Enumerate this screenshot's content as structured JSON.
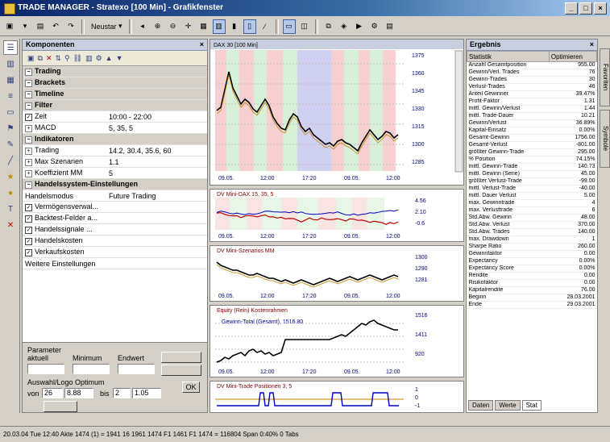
{
  "window": {
    "title": "TRADE MANAGER - Stratexo [100 Min] - Grafikfenster"
  },
  "toolbar": {
    "zoom_label": "Neustar"
  },
  "left_panel": {
    "title": "Komponenten",
    "rows": [
      {
        "type": "group",
        "label": "Trading"
      },
      {
        "type": "group",
        "label": "Brackets"
      },
      {
        "type": "group",
        "label": "Timeline"
      },
      {
        "type": "group",
        "label": "Filter"
      },
      {
        "type": "prop",
        "icon": "check",
        "key": "Zeit",
        "value": "10:00 - 22:00"
      },
      {
        "type": "prop",
        "icon": "plus",
        "key": "MACD",
        "value": "5, 35, 5"
      },
      {
        "type": "group",
        "label": "Indikatoren"
      },
      {
        "type": "prop",
        "icon": "plus",
        "key": "Trading",
        "value": "14.2, 30.4, 35.6, 60"
      },
      {
        "type": "prop",
        "icon": "plus",
        "key": "Max Szenarien",
        "value": "1.1"
      },
      {
        "type": "prop",
        "icon": "plus",
        "key": "Koeffizient MM",
        "value": "5"
      },
      {
        "type": "group",
        "label": "Handelssystem-Einstellungen"
      },
      {
        "type": "prop",
        "icon": "none",
        "key": "Handelsmodus",
        "value": "Future Trading"
      },
      {
        "type": "prop",
        "icon": "check",
        "key": "Vermögensverwal...",
        "value": ""
      },
      {
        "type": "prop",
        "icon": "check",
        "key": "Backtest-Felder a...",
        "value": ""
      },
      {
        "type": "prop",
        "icon": "check",
        "key": "Handelssignale ...",
        "value": ""
      },
      {
        "type": "prop",
        "icon": "check",
        "key": "Handelskosten",
        "value": ""
      },
      {
        "type": "prop",
        "icon": "check",
        "key": "Verkaufskosten",
        "value": ""
      },
      {
        "type": "prop",
        "icon": "none",
        "key": "Weitere Einstellungen",
        "value": ""
      }
    ],
    "params": {
      "label": "Parameter",
      "col1": "aktuell",
      "col2": "Minimum",
      "col3": "Endwert",
      "section_label": "Auswahl/Logo Optimum",
      "from_label": "von",
      "to_label": "bis",
      "from_value": "26",
      "from_value2": "8.88",
      "to_value": "2",
      "to_value2": "1.05",
      "ok_label": "OK"
    }
  },
  "charts": {
    "main": {
      "title": "DAX 30 [100 Min]",
      "price_axis": [
        "1375",
        "1360",
        "1345",
        "1330",
        "1315",
        "1300",
        "1285"
      ],
      "time_axis": [
        "09.05.",
        "12:00",
        "17:20",
        "09.05.",
        "12:00"
      ]
    },
    "ind1": {
      "title": "DV Mini-DAX 15, 35, 5",
      "values": [
        "4.56",
        "2.10",
        "-0.6"
      ]
    },
    "ind2": {
      "title": "DV Mini-Szenarios MM",
      "values": [
        "1300",
        "1290",
        "1281"
      ]
    },
    "equity": {
      "title": "Equity (Rein) Kostenrahmen",
      "sub": "Gewinn-Total (Gesamt), 1516.80",
      "values": [
        "1516",
        "1411",
        "920"
      ]
    },
    "signals": {
      "title": "DV Mini-Trade Positionen 3, 5",
      "values": [
        "1",
        "0",
        "-1"
      ]
    }
  },
  "right_panel": {
    "title": "Ergebnis",
    "col_name": "Statistik",
    "col_value": "Optimieren",
    "rows": [
      [
        "Anzahl Gesamtposition",
        "955.00"
      ],
      [
        "Gewinn/Verl. Trades",
        "76"
      ],
      [
        "Gewinn-Trades",
        "30"
      ],
      [
        "Verlust-Trades",
        "46"
      ],
      [
        "Anteil Gewinner",
        "39.47%"
      ],
      [
        "Profit-Faktor",
        "1.31"
      ],
      [
        "mittl. Gewinn/Verlust",
        "1.44"
      ],
      [
        "mittl. Trade-Dauer",
        "10.21"
      ],
      [
        "Gewinn/Verlust",
        "36.89%"
      ],
      [
        "Kapital-Einsatz",
        "0.00%"
      ],
      [
        "Gesamt-Gewinn",
        "1756.00"
      ],
      [
        "Gesamt-Verlust",
        "-801.00"
      ],
      [
        "größter Gewinn-Trade",
        "295.00"
      ],
      [
        "% Position",
        "74.15%"
      ],
      [
        "mittl. Gewinn-Trade",
        "140.73"
      ],
      [
        "mittl. Gewinn (Serie)",
        "45.00"
      ],
      [
        "größter Verlust-Trade",
        "-99.00"
      ],
      [
        "mittl. Verlust-Trade",
        "-40.00"
      ],
      [
        "mittl. Dauer Verlust",
        "5.00"
      ],
      [
        "max. Gewinntrade",
        "4"
      ],
      [
        "max. Verlusttrade",
        "6"
      ],
      [
        "Std.Abw. Gewinn",
        "48.00"
      ],
      [
        "Std.Abw. Verlust",
        "370.00"
      ],
      [
        "Std.Abw. Trades",
        "140.00"
      ],
      [
        "max. Drawdown",
        "1"
      ],
      [
        "Sharpe Ratio",
        "260.00"
      ],
      [
        "Gewinnfaktor",
        "0.00"
      ],
      [
        "Expectancy",
        "0.00%"
      ],
      [
        "Expectancy Score",
        "0.00%"
      ],
      [
        "Rendite",
        "0.00"
      ],
      [
        "Risikofaktor",
        "0.00"
      ],
      [
        "Kapitalrendite",
        "76.00"
      ],
      [
        "Beginn",
        "28.03.2001"
      ],
      [
        "Ende",
        "29.03.2001"
      ]
    ],
    "tabs": [
      "Daten",
      "Werte",
      "Stat"
    ]
  },
  "side_tabs": [
    "Favoriten",
    "Symbole"
  ],
  "status": {
    "text": "20.03.04 Tue 12:40 Akte 1474 (1) = 1941 16 1961 1474 F1 1461 F1 1474 = 116804 Span 0:40% 0 Tabs"
  }
}
